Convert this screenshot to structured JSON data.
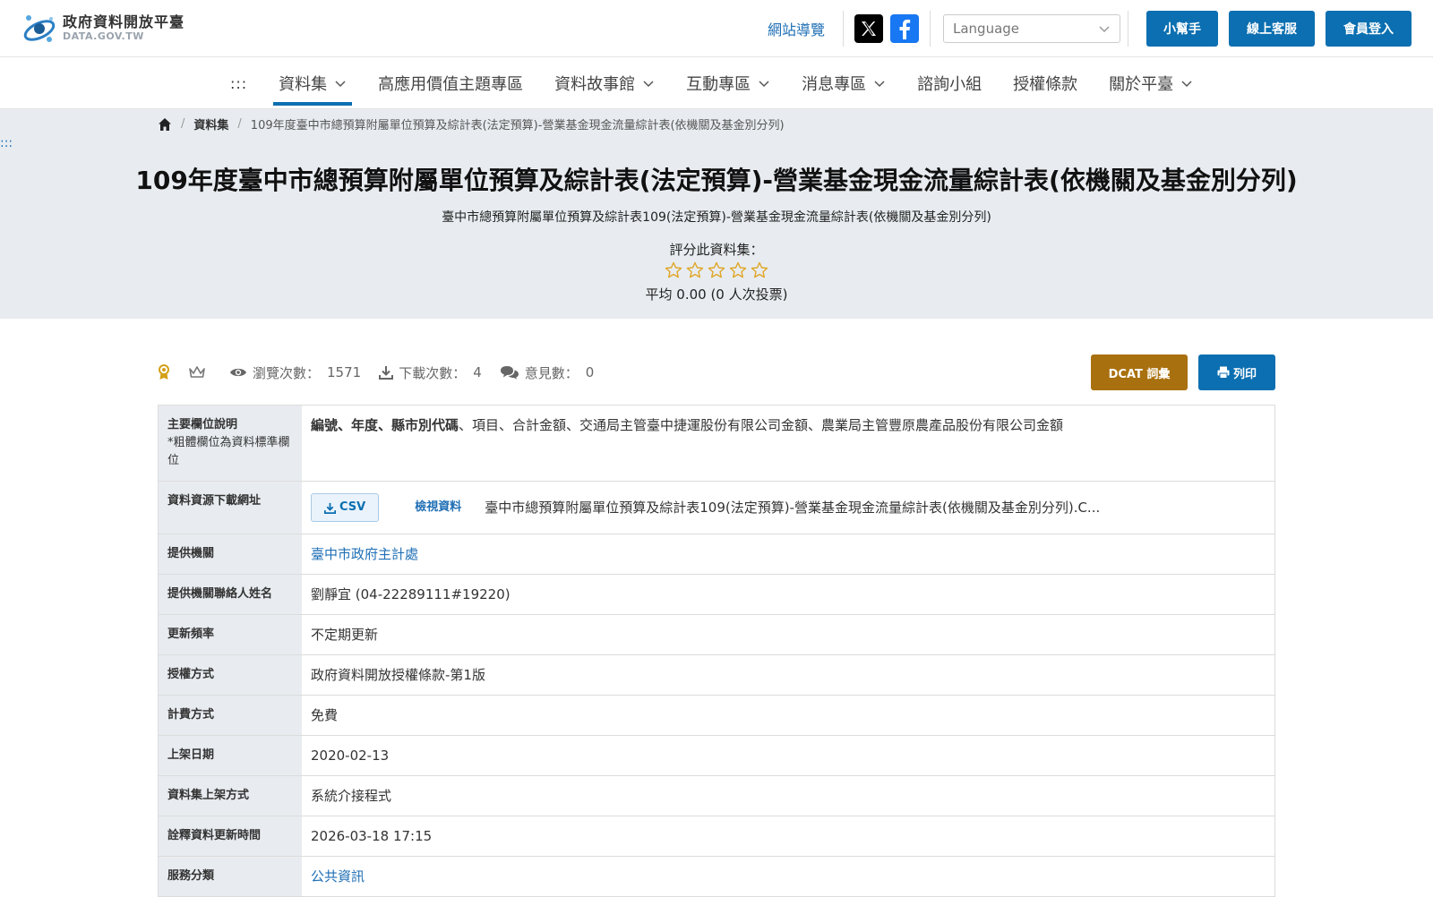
{
  "header": {
    "logo_title": "政府資料開放平臺",
    "logo_sub": "DATA.GOV.TW",
    "sitemap": "網站導覽",
    "language_placeholder": "Language",
    "buttons": [
      "小幫手",
      "線上客服",
      "會員登入"
    ]
  },
  "nav": {
    "dots": ":::",
    "items": [
      {
        "label": "資料集",
        "has_dropdown": true
      },
      {
        "label": "高應用價值主題專區",
        "has_dropdown": false
      },
      {
        "label": "資料故事館",
        "has_dropdown": true
      },
      {
        "label": "互動專區",
        "has_dropdown": true
      },
      {
        "label": "消息專區",
        "has_dropdown": true
      },
      {
        "label": "諮詢小組",
        "has_dropdown": false
      },
      {
        "label": "授權條款",
        "has_dropdown": false
      },
      {
        "label": "關於平臺",
        "has_dropdown": true
      }
    ]
  },
  "banner": {
    "skip": ":::",
    "breadcrumb": {
      "section": "資料集",
      "current": "109年度臺中市總預算附屬單位預算及綜計表(法定預算)-營業基金現金流量綜計表(依機關及基金別分列)"
    },
    "title": "109年度臺中市總預算附屬單位預算及綜計表(法定預算)-營業基金現金流量綜計表(依機關及基金別分列)",
    "subtitle": "臺中市總預算附屬單位預算及綜計表109(法定預算)-營業基金現金流量綜計表(依機關及基金別分列)",
    "rate_label": "評分此資料集：",
    "rating": 0,
    "average": "平均 0.00 (0 人次投票)"
  },
  "stats": {
    "views_label": "瀏覽次數：",
    "views": "1571",
    "downloads_label": "下載次數：",
    "downloads": "4",
    "comments_label": "意見數：",
    "comments": "0",
    "dcat_button": "DCAT 詞彙",
    "print_button": "列印"
  },
  "details": {
    "main_fields_label": "主要欄位說明",
    "main_fields_note": "*粗體欄位為資料標準欄位",
    "main_fields_bold": "編號、年度、縣市別代碼",
    "main_fields_rest": "、項目、合計金額、交通局主管臺中捷運股份有限公司金額、農業局主管豐原農產品股份有限公司金額",
    "download_label": "資料資源下載網址",
    "csv_label": "CSV",
    "view_label": "檢視資料",
    "file_name": "臺中市總預算附屬單位預算及綜計表109(法定預算)-營業基金現金流量綜計表(依機關及基金別分列).C...",
    "rows": [
      {
        "label": "提供機關",
        "value": "臺中市政府主計處",
        "link": true
      },
      {
        "label": "提供機關聯絡人姓名",
        "value": "劉靜宜 (04-22289111#19220)",
        "link": false
      },
      {
        "label": "更新頻率",
        "value": "不定期更新",
        "link": false
      },
      {
        "label": "授權方式",
        "value": "政府資料開放授權條款-第1版",
        "link": false
      },
      {
        "label": "計費方式",
        "value": "免費",
        "link": false
      },
      {
        "label": "上架日期",
        "value": "2020-02-13",
        "link": false
      },
      {
        "label": "資料集上架方式",
        "value": "系統介接程式",
        "link": false
      },
      {
        "label": "詮釋資料更新時間",
        "value": "2026-03-18 17:15",
        "link": false
      },
      {
        "label": "服務分類",
        "value": "公共資訊",
        "link": true
      }
    ]
  },
  "colors": {
    "primary_blue": "#0b6fb1",
    "dcat_brown": "#a9700f",
    "banner_bg": "#e8ecf0",
    "star_gold": "#e0a526"
  }
}
